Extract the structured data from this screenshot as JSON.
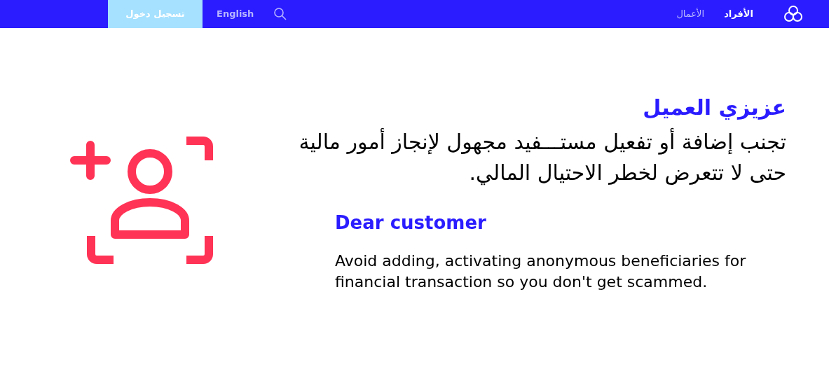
{
  "nav": {
    "login": "تسجيل دخول",
    "language": "English",
    "tabs": [
      {
        "label": "الأفراد",
        "selected": true
      },
      {
        "label": "الأعمال",
        "selected": false
      }
    ]
  },
  "notice": {
    "ar_title": "عزيزي العميل",
    "ar_body": "تجنب إضافة أو تفعيل مستـــفيد مجهول لإنجاز أمور مالية حتى لا تتعرض لخطر الاحتيال المالي.",
    "en_title": "Dear customer",
    "en_body": "Avoid adding, activating anonymous beneficiaries for financial transaction so you don't get scammed."
  }
}
